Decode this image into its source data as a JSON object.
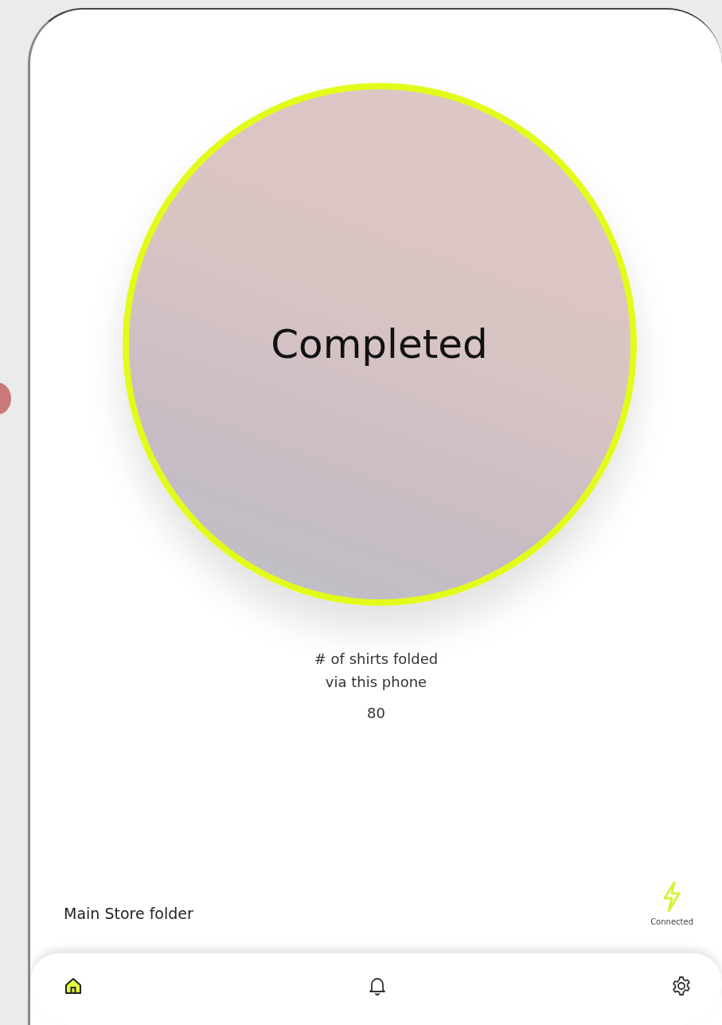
{
  "status": {
    "label": "Completed"
  },
  "stats": {
    "caption_line_1": "# of shirts folded",
    "caption_line_2": "via this phone",
    "value": "80"
  },
  "footer": {
    "folder": "Main Store folder",
    "connection": "Connected"
  },
  "nav": [
    {
      "kind": "home",
      "selected": true
    },
    {
      "kind": "notifications",
      "selected": false
    },
    {
      "kind": "settings",
      "selected": false
    }
  ]
}
